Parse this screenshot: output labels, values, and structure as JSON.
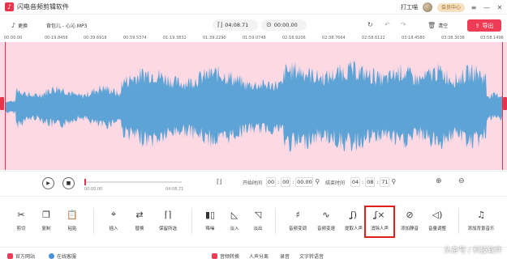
{
  "app": {
    "title": "闪电音频剪辑软件",
    "logo_glyph": "♪"
  },
  "titlebar": {
    "user_name": "打工喵",
    "vip_label": "会员中心",
    "buttons": [
      "≡",
      "—",
      "✕"
    ]
  },
  "toolbar": {
    "replace_label": "更换",
    "file_name": "背包儿 - 心沁.MP3",
    "duration": "04:08.71",
    "position": "00:00.00",
    "clear_label": "清空",
    "export_label": "导出"
  },
  "ruler": {
    "labels": [
      "00:00.00",
      "00:19.8456",
      "00:39.6916",
      "00:59.5374",
      "01:19.3832",
      "01:39.2290",
      "01:59.0748",
      "02:18.9206",
      "02:38.7664",
      "02:58.6122",
      "03:18.4580",
      "03:38.3038",
      "03:58.1496"
    ]
  },
  "transport": {
    "current_time": "00:00.00",
    "total_time": "04:08.71",
    "start_label": "开始时间",
    "start_time": [
      "00",
      "00",
      "00.00"
    ],
    "end_label": "结束时间",
    "end_time": [
      "04",
      "08",
      "71"
    ]
  },
  "tools": [
    {
      "label": "剪切",
      "icon": "scissors-icon",
      "glyph": "✂"
    },
    {
      "label": "复制",
      "icon": "copy-icon",
      "glyph": "❐"
    },
    {
      "label": "粘贴",
      "icon": "paste-icon",
      "glyph": "📋"
    },
    {
      "label": "插入",
      "icon": "insert-icon",
      "glyph": "⌖"
    },
    {
      "label": "替换",
      "icon": "replace-icon",
      "glyph": "⇄"
    },
    {
      "label": "保留所选",
      "icon": "keep-selection-icon",
      "glyph": "⌈⌉"
    },
    {
      "label": "降噪",
      "icon": "denoise-icon",
      "glyph": "▮▯"
    },
    {
      "label": "淡入",
      "icon": "fade-in-icon",
      "glyph": "◺"
    },
    {
      "label": "淡出",
      "icon": "fade-out-icon",
      "glyph": "◹"
    },
    {
      "label": "音频变调",
      "icon": "pitch-icon",
      "glyph": "♯"
    },
    {
      "label": "音频变速",
      "icon": "speed-icon",
      "glyph": "∿"
    },
    {
      "label": "提取人声",
      "icon": "extract-voice-icon",
      "glyph": "ʆ)"
    },
    {
      "label": "消除人声",
      "icon": "remove-voice-icon",
      "glyph": "ʆ×"
    },
    {
      "label": "添加静音",
      "icon": "mute-icon",
      "glyph": "⊘"
    },
    {
      "label": "音量调整",
      "icon": "volume-icon",
      "glyph": "◁)"
    },
    {
      "label": "添加背景音乐",
      "icon": "bg-music-icon",
      "glyph": "♫"
    }
  ],
  "statusbar": {
    "items": [
      "官方网站",
      "在线客服",
      "音频转换",
      "人声分离",
      "录音",
      "文字转语音"
    ]
  },
  "watermark": "头条号 / 科技软件",
  "colors": {
    "accent": "#ef3c56",
    "wave": "#5da3d6",
    "wave_bg": "#fdd9e3",
    "highlight": "#e0201c"
  }
}
